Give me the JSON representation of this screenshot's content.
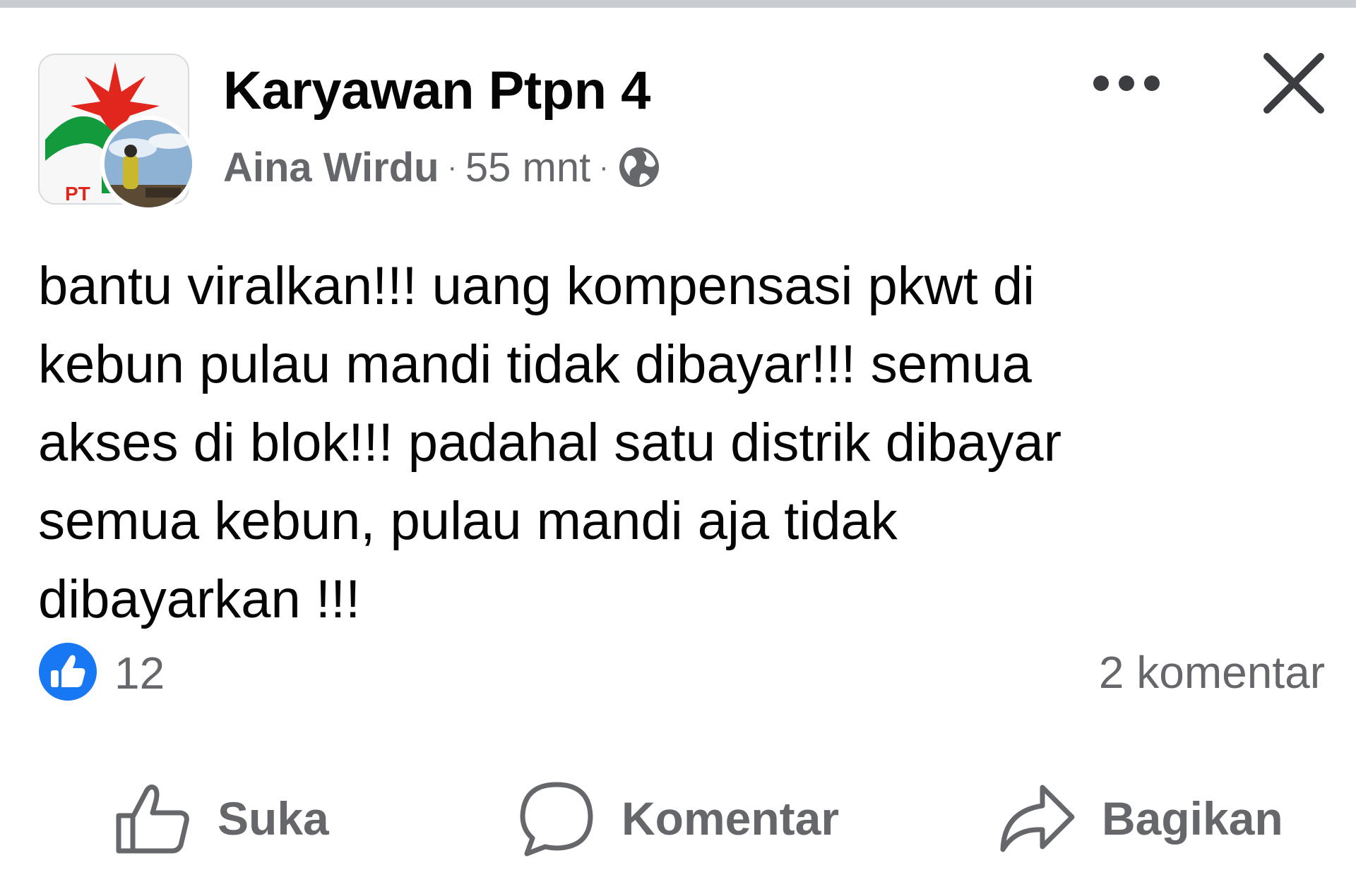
{
  "post": {
    "group_name": "Karyawan Ptpn 4",
    "author": "Aina Wirdu",
    "separator": "·",
    "timestamp": "55 mnt",
    "privacy_icon": "globe-icon",
    "logo_text": "PT",
    "text": "bantu viralkan!!! uang kompensasi pkwt di\nkebun pulau mandi tidak dibayar!!! semua\nakses di blok!!! padahal satu distrik dibayar\nsemua kebun, pulau mandi aja tidak\ndibayarkan !!!"
  },
  "stats": {
    "reaction_count": "12",
    "comments": "2 komentar"
  },
  "actions": {
    "like": "Suka",
    "comment": "Komentar",
    "share": "Bagikan"
  },
  "colors": {
    "text": "#050505",
    "secondary": "#65676b",
    "like_blue": "#1877f2",
    "logo_red": "#e0261d",
    "logo_green": "#139a3c"
  }
}
